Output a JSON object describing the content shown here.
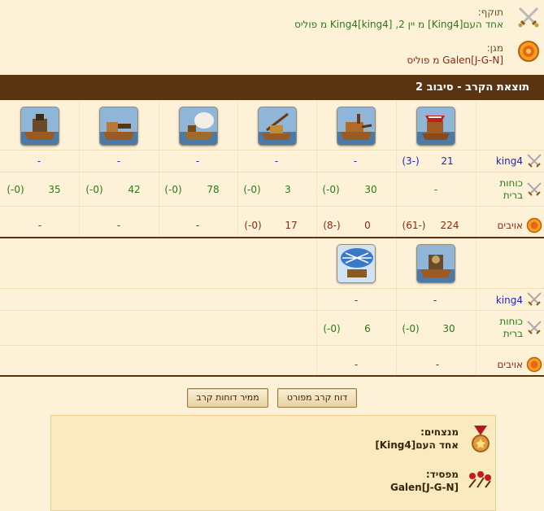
{
  "attacker": {
    "label": "תוקף:",
    "text": "אחד העם[King4] מ יין 2, King4[king4] מ פוליס"
  },
  "defender": {
    "label": "מגן:",
    "text": "Galen[J-G-N] מ פוליס"
  },
  "header": {
    "title": "תוצאת הקרב - סיבוב 2"
  },
  "round1": {
    "units": [
      "heavy-ship-icon",
      "ram-ship-icon",
      "flamethrower-ship-icon",
      "catapult-ship-icon",
      "ballista-ship-icon",
      "mortar-ship-icon"
    ],
    "king4_row": {
      "label": "king4",
      "values": [
        [
          "21",
          "(-3)"
        ],
        [
          "-",
          ""
        ],
        [
          "-",
          ""
        ],
        [
          "-",
          ""
        ],
        [
          "-",
          ""
        ],
        [
          "-",
          ""
        ]
      ]
    },
    "allies_row": {
      "label": "כוחות ברית",
      "values": [
        [
          "-",
          ""
        ],
        [
          "30",
          "(0-)"
        ],
        [
          "3",
          "(0-)"
        ],
        [
          "78",
          "(0-)"
        ],
        [
          "42",
          "(0-)"
        ],
        [
          "35",
          "(0-)"
        ]
      ]
    },
    "enemies_row": {
      "label": "אויבים",
      "values": [
        [
          "224",
          "(-61)"
        ],
        [
          "0",
          "(-8)"
        ],
        [
          "17",
          "(0-)"
        ],
        [
          "-",
          ""
        ],
        [
          "-",
          ""
        ],
        [
          "-",
          ""
        ]
      ]
    }
  },
  "round2": {
    "units": [
      "steam-ram-icon",
      "gyro-balloon-icon"
    ],
    "king4_row": {
      "label": "king4",
      "values": [
        [
          "-",
          ""
        ],
        [
          "-",
          ""
        ]
      ]
    },
    "allies_row": {
      "label": "כוחות ברית",
      "values": [
        [
          "30",
          "(0-)"
        ],
        [
          "6",
          "(0-)"
        ]
      ]
    },
    "enemies_row": {
      "label": "אויבים",
      "values": [
        [
          "-",
          ""
        ],
        [
          "-",
          ""
        ]
      ]
    }
  },
  "buttons": {
    "detailed": "דוח קרב מפורט",
    "archive": "ממיר דוחות קרב"
  },
  "summary": {
    "winners_label": "מנצחים:",
    "winners_value": "אחד העם[King4]",
    "loser_label": "מפסיד:",
    "loser_value": "Galen[J-G-N]"
  },
  "colors": {
    "header_bg": "#5a3310",
    "page_bg": "#fdf1d8",
    "blue": "#2222cc",
    "green": "#2a7a1a",
    "brown": "#8a2b10"
  }
}
